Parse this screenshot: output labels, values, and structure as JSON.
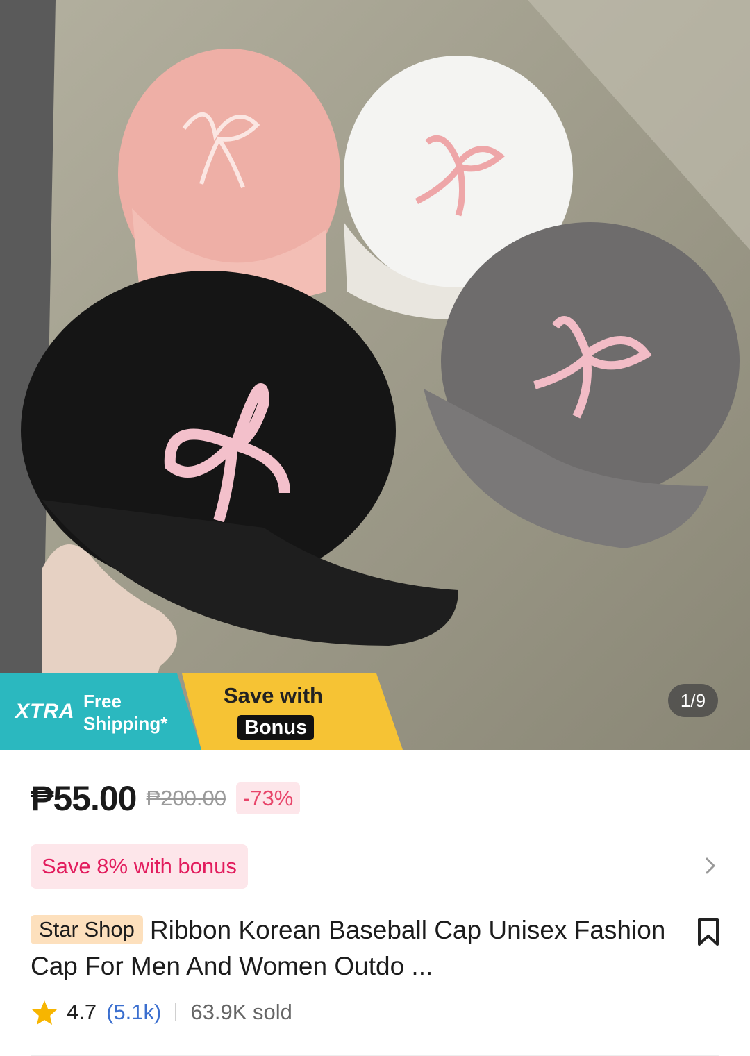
{
  "gallery": {
    "counter": "1/9",
    "image_alt": "Four ribbon baseball caps: pink, white, black and grey with pink embroidered bows"
  },
  "promo": {
    "xtra_logo": "XTRA",
    "free_line1": "Free",
    "free_line2": "Shipping*",
    "save_with": "Save with",
    "bonus": "Bonus"
  },
  "product": {
    "price": "₱55.00",
    "original_price": "₱200.00",
    "discount": "-73%",
    "bonus_banner": "Save 8% with bonus",
    "shop": "Star Shop",
    "title": "Ribbon Korean Baseball Cap Unisex Fashion Cap For Men And Women Outdo ...",
    "rating": "4.7",
    "reviews": "(5.1k)",
    "sold": "63.9K sold"
  },
  "colors": {
    "teal": "#2bb8bf",
    "yellow": "#f6c334",
    "pink_text": "#e21c5d",
    "link_blue": "#3b6fcf",
    "star": "#f7b500"
  },
  "icons": [
    "chevron-right-icon",
    "bookmark-icon",
    "star-icon"
  ]
}
